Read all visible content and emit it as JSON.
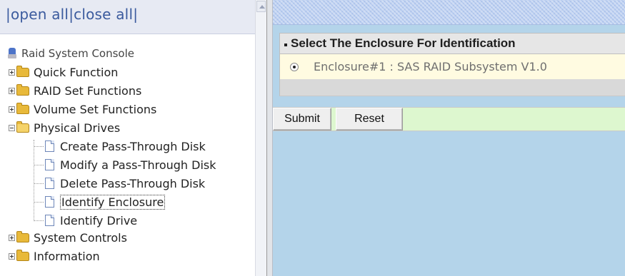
{
  "tree": {
    "open_all": "open all",
    "close_all": "close all",
    "root_label": "Raid System Console",
    "items": [
      {
        "label": "Quick Function",
        "expanded": false
      },
      {
        "label": "RAID Set Functions",
        "expanded": false
      },
      {
        "label": "Volume Set Functions",
        "expanded": false
      },
      {
        "label": "Physical Drives",
        "expanded": true,
        "children": [
          {
            "label": "Create Pass-Through Disk"
          },
          {
            "label": "Modify a Pass-Through Disk"
          },
          {
            "label": "Delete Pass-Through Disk"
          },
          {
            "label": "Identify Enclosure",
            "selected": true
          },
          {
            "label": "Identify Drive"
          }
        ]
      },
      {
        "label": "System Controls",
        "expanded": false
      },
      {
        "label": "Information",
        "expanded": false
      }
    ]
  },
  "panel": {
    "header": "Select The Enclosure For Identification",
    "enclosure_option": "Enclosure#1 : SAS RAID Subsystem V1.0",
    "enclosure_selected": true
  },
  "buttons": {
    "submit": "Submit",
    "reset": "Reset"
  },
  "colors": {
    "link": "#3b5b9e",
    "right_background": "#b4d4ea",
    "button_row": "#ddf7cf",
    "option_row": "#fffbe1"
  }
}
